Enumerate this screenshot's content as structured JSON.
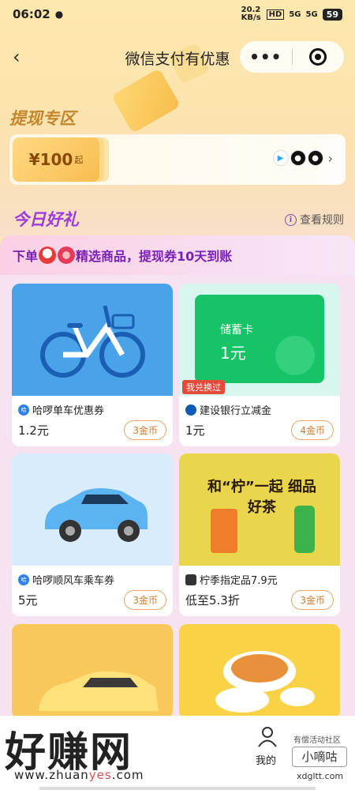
{
  "status_bar": {
    "time": "06:02",
    "net_speed": "20.2 KB/s",
    "signal1": "5G",
    "signal2": "5G",
    "hd": "HD",
    "battery": "59"
  },
  "nav": {
    "title": "微信支付有优惠",
    "more_label": "•••"
  },
  "withdraw": {
    "title": "提现专区",
    "amount": "¥100",
    "suffix": "起"
  },
  "today": {
    "title": "今日好礼",
    "rules_label": "查看规则"
  },
  "banner": {
    "prefix": "下单",
    "text": "精选商品，提现券10天到账"
  },
  "products": [
    {
      "name": "哈啰单车优惠券",
      "price": "1.2元",
      "coins": "3金币",
      "brand": "哈啰"
    },
    {
      "name": "建设银行立减金",
      "price": "1元",
      "coins": "4金币",
      "tag": "我兑换过",
      "card_title": "储蓄卡",
      "card_value": "1元"
    },
    {
      "name": "哈啰顺风车乘车券",
      "price": "5元",
      "coins": "3金币",
      "brand": "哈啰"
    },
    {
      "name": "柠季指定品7.9元",
      "price": "低至5.3折",
      "coins": "3金币",
      "poster_text": "和“柠”一起 细品好茶"
    }
  ],
  "bottom": {
    "mine_label": "我的",
    "wm_logo": "好赚网",
    "wm_url_1": "www.zhuan",
    "wm_url_2": "yes",
    "wm_url_3": ".com",
    "small_wm": "有偿活动社区",
    "small_btn": "小嘀咕",
    "xdg": "xdgltt.com"
  },
  "colors": {
    "accent_purple": "#9b3be0",
    "coin_orange": "#d07a2a",
    "zone_gold": "#c3862c"
  }
}
